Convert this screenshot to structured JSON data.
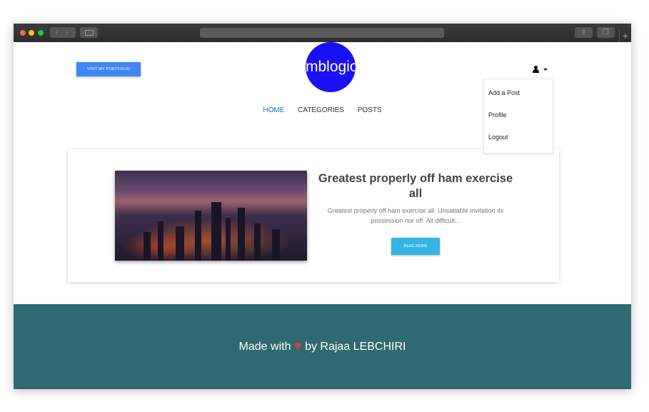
{
  "header": {
    "portfolio_button": "VISIT MY PORTFOLIO",
    "logo": "mblogio",
    "user_icon": "user-icon",
    "dropdown": [
      "Add a Post",
      "Profile",
      "Logout"
    ]
  },
  "nav": [
    "HOME",
    "CATEGORIES",
    "POSTS"
  ],
  "post": {
    "title": "Greatest properly off ham exercise all",
    "excerpt": "Greatest properly off ham exercise all. Unsatiable invitation its possession nor off. All difficult...",
    "read_more": "READ MORE"
  },
  "footer": {
    "made_with": "Made with",
    "heart": "♥",
    "by": "by Rajaa LEBCHIRI"
  },
  "colors": {
    "accent": "#1a73c8",
    "logo_bg": "#1a10f5",
    "portfolio_btn": "#4285f4",
    "read_more_btn": "#33b5e5",
    "footer_bg": "#2e6a70",
    "heart": "#e53935"
  }
}
